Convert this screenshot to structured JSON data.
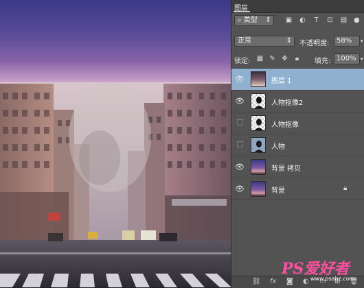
{
  "canvas": {
    "alt": "city street image"
  },
  "panel": {
    "tab_label": "图层",
    "filter": {
      "icon": "search-icon",
      "label": "类型"
    },
    "blend_mode": "正常",
    "opacity_label": "不透明度:",
    "opacity_value": "58%",
    "lock_label": "锁定:",
    "fill_label": "填充:",
    "fill_value": "100%",
    "layers": [
      {
        "name": "图层 1",
        "visible": true,
        "selected": true
      },
      {
        "name": "人物抠像2",
        "visible": true,
        "selected": false
      },
      {
        "name": "人物抠像",
        "visible": false,
        "selected": false
      },
      {
        "name": "人物",
        "visible": false,
        "selected": false
      },
      {
        "name": "背景 拷贝",
        "visible": true,
        "selected": false
      },
      {
        "name": "背景",
        "visible": true,
        "selected": false,
        "locked": true
      }
    ]
  },
  "watermark": {
    "brand": "PS爱好者",
    "url": "www.psahz.com"
  }
}
